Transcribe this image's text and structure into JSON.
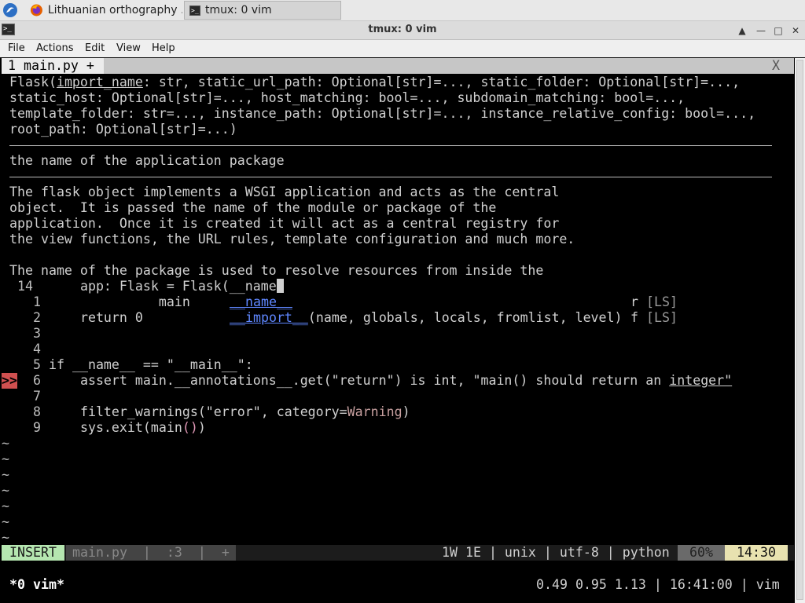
{
  "taskbar": {
    "tasks": [
      {
        "label": "Lithuanian orthography ..."
      },
      {
        "label": "tmux: 0 vim"
      }
    ]
  },
  "window": {
    "title": "tmux: 0 vim",
    "menu": [
      "File",
      "Actions",
      "Edit",
      "View",
      "Help"
    ]
  },
  "vim": {
    "tab_label": "1 main.py +",
    "tab_close": "X",
    "popup": {
      "signature": [
        "Flask(import_name: str, static_url_path: Optional[str]=..., static_folder: Optional[str]=...,",
        "static_host: Optional[str]=..., host_matching: bool=..., subdomain_matching: bool=...,",
        "template_folder: str=..., instance_path: Optional[str]=..., instance_relative_config: bool=...,",
        "root_path: Optional[str]=...)"
      ],
      "param_doc": "the name of the application package",
      "doc": [
        "The flask object implements a WSGI application and acts as the central",
        "object.  It is passed the name of the module or package of the",
        "application.  Once it is created it will act as a central registry for",
        "the view functions, the URL rules, template configuration and much more.",
        "",
        "The name of the package is used to resolve resources from inside the"
      ]
    },
    "current_line_number": "14",
    "current_line": "    app: Flask = Flask(__name",
    "completion": [
      {
        "num": "1",
        "left": "              main",
        "item": "__name__",
        "kind": "r",
        "src": "[LS]"
      },
      {
        "num": "2",
        "left": "    return 0",
        "item": "__import__",
        "args": "(name, globals, locals, fromlist, level)",
        "kind": "f",
        "src": "[LS]"
      }
    ],
    "lines": [
      {
        "num": "3",
        "text": ""
      },
      {
        "num": "4",
        "text": ""
      },
      {
        "num": "5",
        "text": "if __name__ == \"__main__\":"
      },
      {
        "num": "6",
        "text": "    assert main.__annotations__.get(\"return\") is int, \"main() should return an integer\""
      },
      {
        "num": "7",
        "text": ""
      },
      {
        "num": "8",
        "text": "    filter_warnings(\"error\", category=Warning)"
      },
      {
        "num": "9",
        "text": "    sys.exit(main())"
      }
    ],
    "sign": ">>",
    "tilde": "~",
    "status": {
      "mode": "INSERT",
      "file": "main.py  |  :3  |  +",
      "right": "1W 1E | unix | utf-8 | python",
      "percent": "60%",
      "position": "14:30"
    }
  },
  "tmux": {
    "window": "*0 vim*",
    "right": "0.49 0.95 1.13 | 16:41:00 | vim"
  }
}
